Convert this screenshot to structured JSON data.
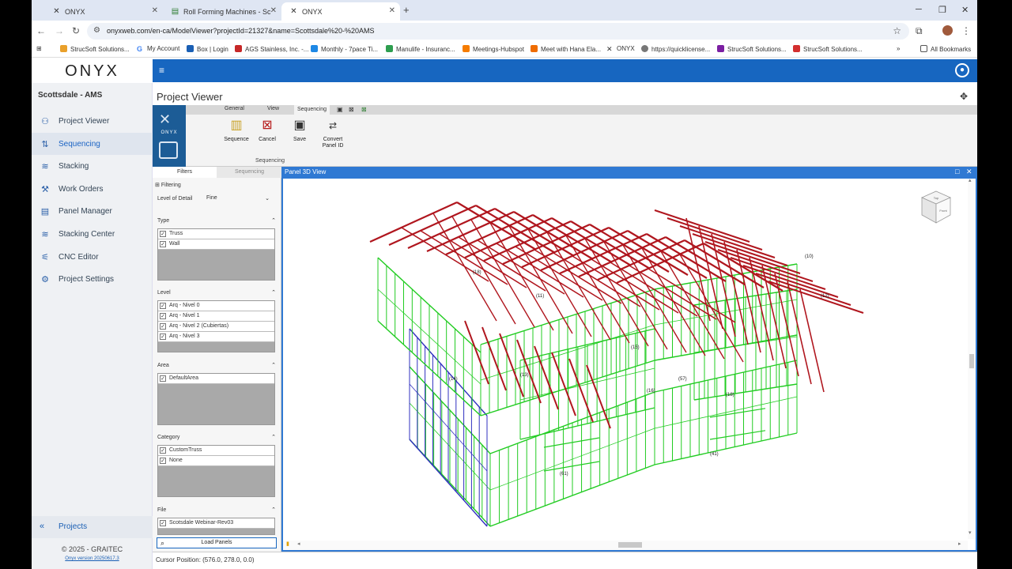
{
  "browser": {
    "tabs": [
      {
        "title": "ONYX",
        "active": false
      },
      {
        "title": "Roll Forming Machines - Scotts",
        "active": false
      },
      {
        "title": "ONYX",
        "active": true
      }
    ],
    "url": "onyxweb.com/en-ca/ModelViewer?projectId=21327&name=Scottsdale%20-%20AMS",
    "bookmarks": [
      "StrucSoft Solutions...",
      "My Account",
      "Box | Login",
      "AGS Stainless, Inc. -...",
      "Monthly - 7pace Ti...",
      "Manulife - Insuranc...",
      "Meetings-Hubspot",
      "Meet with Hana Ela...",
      "ONYX",
      "https://quicklicense...",
      "StrucSoft Solutions...",
      "StrucSoft Solutions..."
    ],
    "all_bookmarks": "All Bookmarks"
  },
  "app": {
    "logo": "ONYX",
    "project_name": "Scottsdale - AMS",
    "nav": [
      {
        "label": "Project Viewer",
        "icon": "project-viewer-icon",
        "active": false
      },
      {
        "label": "Sequencing",
        "icon": "sequencing-icon",
        "active": true
      },
      {
        "label": "Stacking",
        "icon": "stacking-icon",
        "active": false
      },
      {
        "label": "Work Orders",
        "icon": "work-orders-icon",
        "active": false
      },
      {
        "label": "Panel Manager",
        "icon": "panel-manager-icon",
        "active": false
      },
      {
        "label": "Stacking Center",
        "icon": "stacking-center-icon",
        "active": false
      },
      {
        "label": "CNC Editor",
        "icon": "cnc-editor-icon",
        "active": false
      },
      {
        "label": "Project Settings",
        "icon": "gear-icon",
        "active": false
      }
    ],
    "projects_label": "Projects",
    "copyright": "© 2025 - GRAITEC",
    "version": "Onyx version 20250617.3",
    "page_title": "Project Viewer"
  },
  "ribbon": {
    "logo_text": "ONYX",
    "tabs": [
      "General",
      "View",
      "Sequencing"
    ],
    "active_tab": "Sequencing",
    "buttons": [
      {
        "label": "Sequence",
        "icon": "sequence-icon"
      },
      {
        "label": "Cancel",
        "icon": "cancel-icon"
      },
      {
        "label": "Save",
        "icon": "save-icon"
      },
      {
        "label": "Convert Panel ID",
        "icon": "convert-panel-id-icon"
      }
    ],
    "group_label": "Sequencing"
  },
  "filters": {
    "tabs": [
      "Filters",
      "Sequencing"
    ],
    "active_tab": "Filters",
    "filtering_label": "Filtering",
    "lod_label": "Level of Detail",
    "lod_value": "Fine",
    "sections": [
      {
        "title": "Type",
        "items": [
          "Truss",
          "Wall"
        ]
      },
      {
        "title": "Level",
        "items": [
          "Arq - Nivel 0",
          "Arq - Nivel 1",
          "Arq - Nivel 2 (Cubiertas)",
          "Arq - Nivel 3"
        ]
      },
      {
        "title": "Area",
        "items": [
          "DefaultArea"
        ]
      },
      {
        "title": "Category",
        "items": [
          "CustomTruss",
          "None"
        ]
      },
      {
        "title": "File",
        "items": [
          "Scotsdale Webinar-Rev03"
        ]
      }
    ],
    "load_button": "Load Panels"
  },
  "viewer": {
    "title": "Panel 3D View",
    "colors": {
      "truss": "#b0161e",
      "wall": "#22cc22",
      "selected": "#3030c0"
    },
    "cube_top": "Top",
    "cube_front": "Front",
    "labels": [
      "(14)",
      "(13)",
      "(15)",
      "(16)",
      "(57)",
      "(18)",
      "(10)",
      "(12)",
      "(61)",
      "(41)",
      "(18)",
      "(11)"
    ]
  },
  "status": {
    "cursor_position": "Cursor Position: (576.0, 278.0, 0.0)"
  }
}
